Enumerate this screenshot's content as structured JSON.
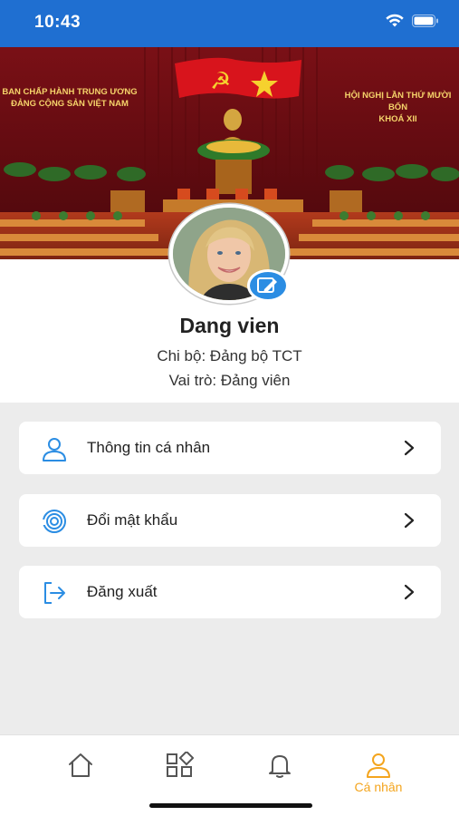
{
  "status_bar": {
    "time": "10:43"
  },
  "banner": {
    "left_caption_line1": "BAN CHẤP HÀNH TRUNG ƯƠNG",
    "left_caption_line2": "ĐẢNG CỘNG SẢN VIỆT NAM",
    "right_caption_line1": "HỘI NGHỊ LẦN THỨ MƯỜI BỐN",
    "right_caption_line2": "KHOÁ XII"
  },
  "profile": {
    "name": "Dang vien",
    "branch": "Chi bộ: Đảng bộ TCT",
    "role": "Vai trò: Đảng viên"
  },
  "menu": [
    {
      "label": "Thông tin cá nhân",
      "icon": "user-icon"
    },
    {
      "label": "Đổi mật khẩu",
      "icon": "fingerprint-icon"
    },
    {
      "label": "Đăng xuất",
      "icon": "logout-icon"
    }
  ],
  "tabs": [
    {
      "icon": "home-icon",
      "label": ""
    },
    {
      "icon": "grid-icon",
      "label": ""
    },
    {
      "icon": "bell-icon",
      "label": ""
    },
    {
      "icon": "user-icon",
      "label": "Cá nhân",
      "active": true
    }
  ],
  "colors": {
    "status_bar": "#1f6fd1",
    "accent": "#2b8de3",
    "active_tab": "#f4a51e",
    "background": "#ececec"
  }
}
